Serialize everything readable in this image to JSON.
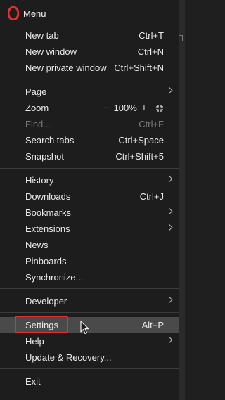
{
  "header": {
    "title": "Menu"
  },
  "items": [
    {
      "label": "New tab",
      "shortcut": "Ctrl+T"
    },
    {
      "label": "New window",
      "shortcut": "Ctrl+N"
    },
    {
      "label": "New private window",
      "shortcut": "Ctrl+Shift+N"
    },
    {
      "label": "Page",
      "shortcut": ""
    },
    {
      "label": "Zoom",
      "zoom": {
        "minus": "−",
        "value": "100%",
        "plus": "+"
      }
    },
    {
      "label": "Find...",
      "shortcut": "Ctrl+F"
    },
    {
      "label": "Search tabs",
      "shortcut": "Ctrl+Space"
    },
    {
      "label": "Snapshot",
      "shortcut": "Ctrl+Shift+5"
    },
    {
      "label": "History",
      "shortcut": ""
    },
    {
      "label": "Downloads",
      "shortcut": "Ctrl+J"
    },
    {
      "label": "Bookmarks",
      "shortcut": ""
    },
    {
      "label": "Extensions",
      "shortcut": ""
    },
    {
      "label": "News",
      "shortcut": ""
    },
    {
      "label": "Pinboards",
      "shortcut": ""
    },
    {
      "label": "Synchronize...",
      "shortcut": ""
    },
    {
      "label": "Developer",
      "shortcut": ""
    },
    {
      "label": "Settings",
      "shortcut": "Alt+P"
    },
    {
      "label": "Help",
      "shortcut": ""
    },
    {
      "label": "Update & Recovery...",
      "shortcut": ""
    },
    {
      "label": "Exit",
      "shortcut": ""
    }
  ],
  "colors": {
    "accent": "#e3302b",
    "background": "#1d1d1d",
    "hover": "#4a4a4a"
  }
}
